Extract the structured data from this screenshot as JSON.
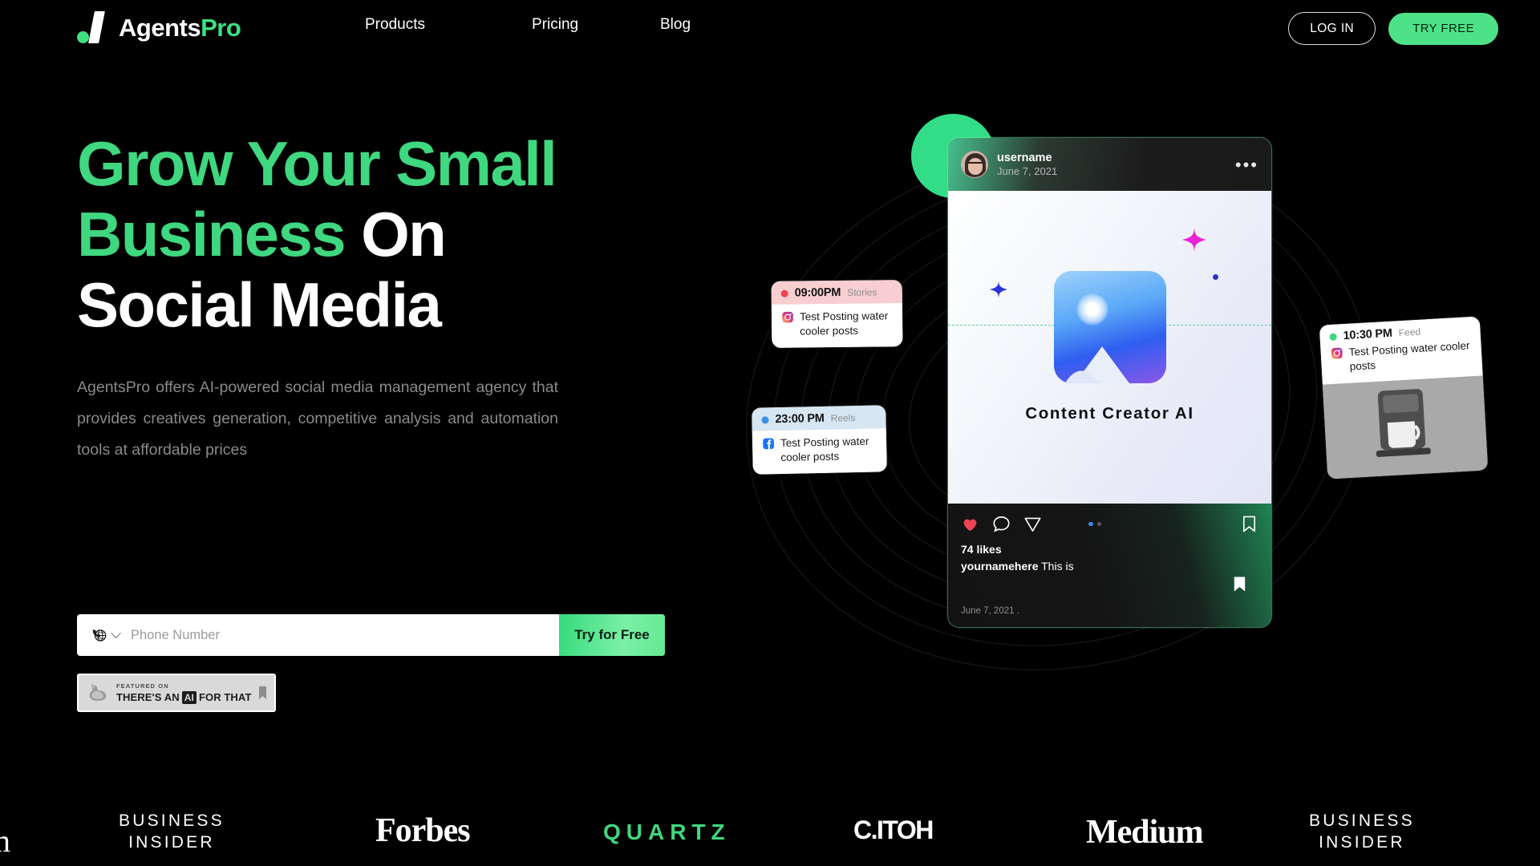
{
  "brand": {
    "name_primary": "Agents",
    "name_accent": "Pro",
    "accent_color": "#3ee07f",
    "logo_icon": "dot-slash-logo"
  },
  "nav": {
    "items": [
      {
        "label": "Products"
      },
      {
        "label": "Pricing"
      },
      {
        "label": "Blog"
      }
    ]
  },
  "header_actions": {
    "login_label": "LOG IN",
    "tryfree_label": "TRY FREE"
  },
  "hero": {
    "headline_green": "Grow Your Small Business ",
    "headline_white_1": "On\nSocial Media",
    "subhead": "AgentsPro offers AI-powered social media management agency that provides creatives generation, competitive analysis and automation tools at affordable prices"
  },
  "form": {
    "country_icon": "globe-phone-icon",
    "chevron_icon": "chevron-down-icon",
    "phone_placeholder": "Phone Number",
    "phone_value": "",
    "submit_label": "Try for Free"
  },
  "featured_badge": {
    "icon": "flexed-arm-icon",
    "top_line": "FEATURED ON",
    "bottom_pre": "THERE'S AN",
    "bottom_ai": "AI",
    "bottom_post": "FOR THAT",
    "bookmark_icon": "bookmark-icon"
  },
  "post": {
    "avatar": "user-avatar",
    "username": "username",
    "date": "June 7, 2021",
    "menu_icon": "more-options-icon",
    "media_icon": "image-placeholder-icon",
    "media_caption": "Content Creator AI",
    "actions": {
      "like_icon": "heart-icon",
      "comment_icon": "comment-icon",
      "share_icon": "share-icon",
      "save_icon": "bookmark-icon"
    },
    "likes": "74  likes",
    "caption_user": "yournamehere",
    "caption_text": " This is",
    "timestamp": "June 7, 2021 ."
  },
  "schedule_cards": [
    {
      "time": "09:00PM",
      "tag": "Stories",
      "dot_color": "#ef4452",
      "platform_icon": "instagram-icon",
      "text": "Test Posting water cooler posts"
    },
    {
      "time": "23:00 PM",
      "tag": "Reels",
      "dot_color": "#3b8fe8",
      "platform_icon": "facebook-icon",
      "text": "Test Posting water cooler posts"
    },
    {
      "time": "10:30 PM",
      "tag": "Feed",
      "dot_color": "#3fd77f",
      "platform_icon": "instagram-icon",
      "text": "Test Posting water cooler posts"
    }
  ],
  "press_logos": [
    {
      "name": "medium-partial",
      "text": "m"
    },
    {
      "name": "business-insider",
      "line1": "BUSINESS",
      "line2": "INSIDER"
    },
    {
      "name": "forbes",
      "text": "Forbes"
    },
    {
      "name": "quartz",
      "text": "QUARTZ"
    },
    {
      "name": "c-itoh",
      "text": "C.ITOH"
    },
    {
      "name": "medium",
      "text": "Medium"
    },
    {
      "name": "business-insider-2",
      "line1": "BUSINESS",
      "line2": "INSIDER"
    }
  ]
}
